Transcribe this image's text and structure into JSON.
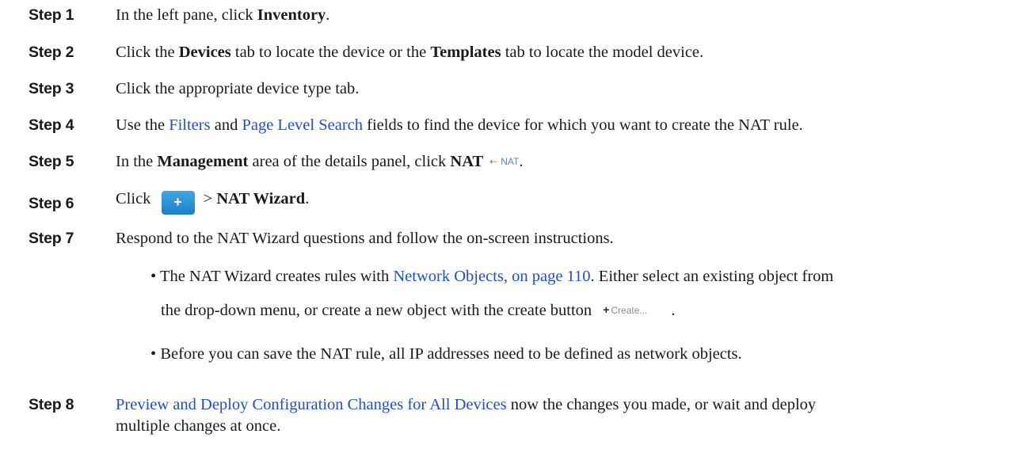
{
  "steps": [
    {
      "label": "Step 1",
      "pre": "In the left pane, click ",
      "b1": "Inventory",
      "post": "."
    },
    {
      "label": "Step 2",
      "pre": "Click the ",
      "b1": "Devices",
      "mid": " tab to locate the device or the ",
      "b2": "Templates",
      "post": " tab to locate the model device."
    },
    {
      "label": "Step 3",
      "text": "Click the appropriate device type tab."
    },
    {
      "label": "Step 4",
      "pre": "Use the ",
      "link1": "Filters",
      "mid": " and ",
      "link2": "Page Level Search",
      "post": " fields to find the device for which you want to create the NAT rule."
    },
    {
      "label": "Step 5",
      "pre": "In the ",
      "b1": "Management",
      "mid": " area of the details panel, click ",
      "b2": "NAT",
      "icon_label": "NAT",
      "icon_symbol": "⇠",
      "post": "."
    },
    {
      "label": "Step 6",
      "pre": "Click ",
      "button_symbol": "+",
      "mid": " > ",
      "b1": "NAT Wizard",
      "post": "."
    },
    {
      "label": "Step 7",
      "text": "Respond to the NAT Wizard questions and follow the on-screen instructions."
    },
    {
      "label": "Step 8",
      "link1": "Preview and Deploy Configuration Changes for All Devices",
      "post": " now the changes you made, or wait and deploy",
      "cont": "multiple changes at once."
    }
  ],
  "bullets": [
    {
      "pre": "The NAT Wizard creates rules with ",
      "link": "Network Objects, on page 110",
      "post": ". Either select an existing object from",
      "cont": "the drop-down menu, or create a new object with the create button",
      "button_label": "Create...",
      "button_symbol": "+",
      "end": "."
    },
    {
      "text": "Before you can save the NAT rule, all IP addresses need to be defined as network objects."
    }
  ],
  "colors": {
    "link": "#1f4fcf",
    "text": "#1a1a1a",
    "button": "#1b7fc8"
  }
}
